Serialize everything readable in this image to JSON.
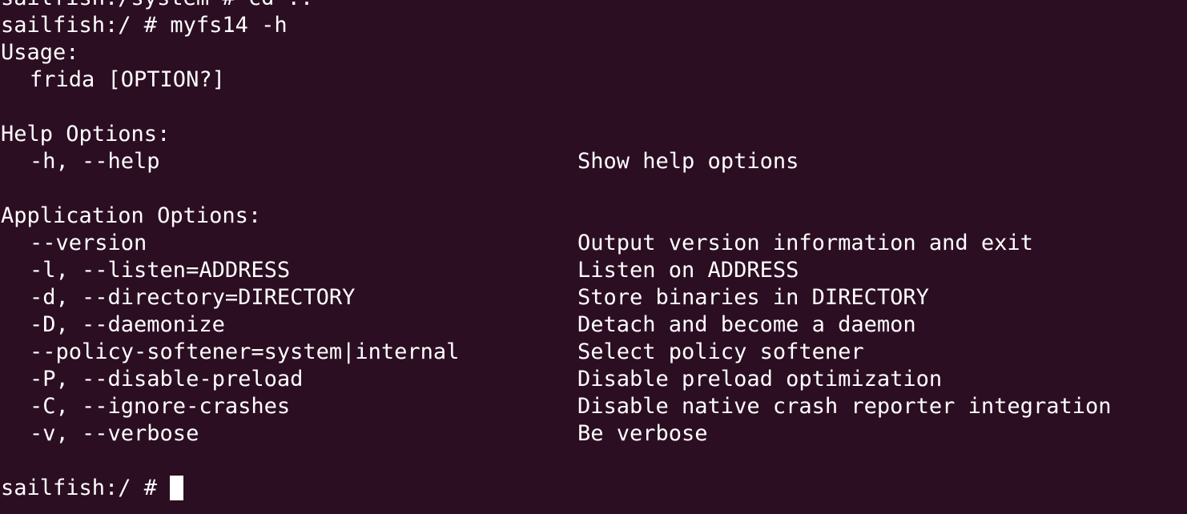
{
  "terminal": {
    "bg_color": "#2c0e23",
    "fg_color": "#ffffff",
    "partial_top_line": "sailfish:/system # cd ..",
    "command_line": "sailfish:/ # myfs14 -h",
    "usage_header": "Usage:",
    "usage_command": "frida [OPTION?]",
    "help_header": "Help Options:",
    "help_options": [
      {
        "option": "-h, --help",
        "description": "Show help options"
      }
    ],
    "app_header": "Application Options:",
    "app_options": [
      {
        "option": "--version",
        "description": "Output version information and exit"
      },
      {
        "option": "-l, --listen=ADDRESS",
        "description": "Listen on ADDRESS"
      },
      {
        "option": "-d, --directory=DIRECTORY",
        "description": "Store binaries in DIRECTORY"
      },
      {
        "option": "-D, --daemonize",
        "description": "Detach and become a daemon"
      },
      {
        "option": "--policy-softener=system|internal",
        "description": "Select policy softener"
      },
      {
        "option": "-P, --disable-preload",
        "description": "Disable preload optimization"
      },
      {
        "option": "-C, --ignore-crashes",
        "description": "Disable native crash reporter integration"
      },
      {
        "option": "-v, --verbose",
        "description": "Be verbose"
      }
    ],
    "prompt": "sailfish:/ #"
  }
}
